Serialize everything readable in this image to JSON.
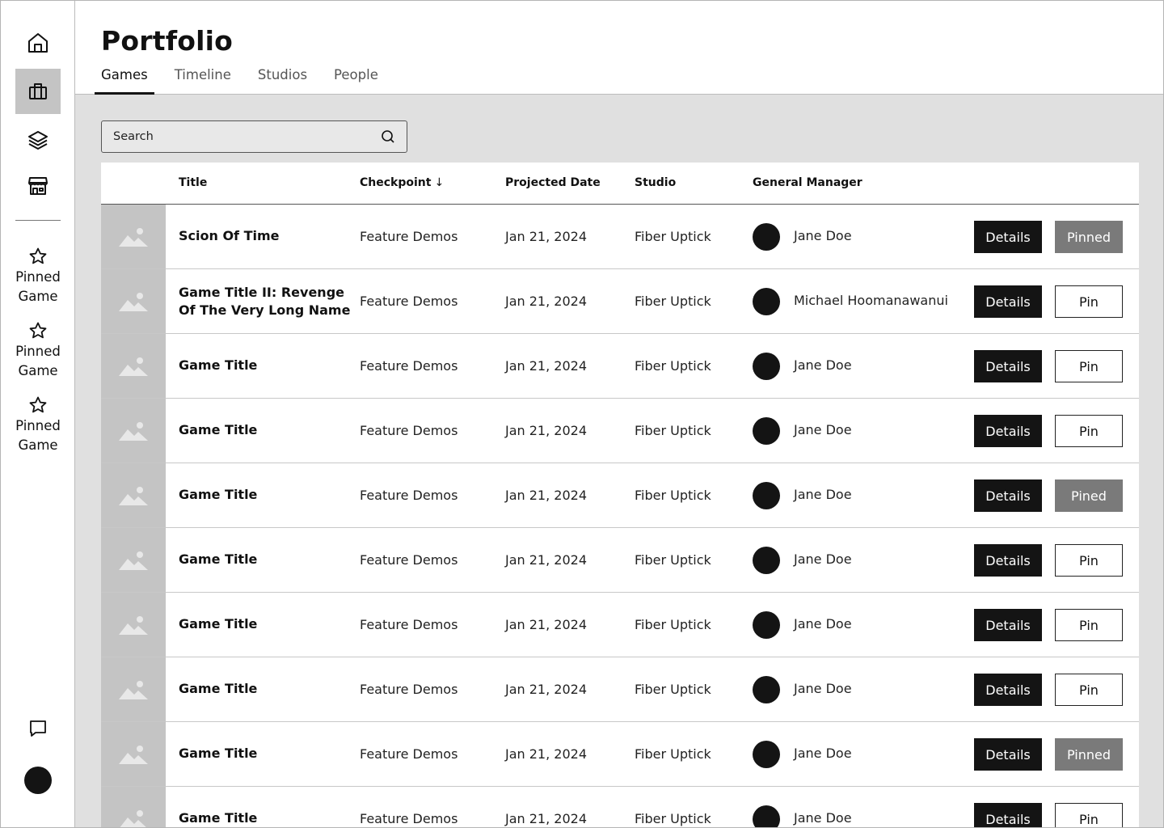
{
  "app": {
    "title": "Portfolio"
  },
  "sidebar": {
    "nav": [
      {
        "icon": "home-icon",
        "active": false
      },
      {
        "icon": "briefcase-icon",
        "active": true
      },
      {
        "icon": "layers-icon",
        "active": false
      },
      {
        "icon": "store-icon",
        "active": false
      }
    ],
    "pinned": [
      {
        "label": "Pinned Game",
        "icon": "star-icon"
      },
      {
        "label": "Pinned Game",
        "icon": "star-icon"
      },
      {
        "label": "Pinned Game",
        "icon": "star-icon"
      }
    ],
    "bottom": {
      "chat_icon": "chat-icon",
      "avatar": "user-avatar"
    }
  },
  "tabs": [
    {
      "label": "Games",
      "active": true
    },
    {
      "label": "Timeline",
      "active": false
    },
    {
      "label": "Studios",
      "active": false
    },
    {
      "label": "People",
      "active": false
    }
  ],
  "search": {
    "placeholder": "Search",
    "value": ""
  },
  "table": {
    "columns": {
      "title": "Title",
      "checkpoint": "Checkpoint",
      "checkpoint_sort": "↓",
      "projected_date": "Projected Date",
      "studio": "Studio",
      "general_manager": "General Manager"
    },
    "details_label": "Details",
    "rows": [
      {
        "title": "Scion Of Time",
        "checkpoint": "Feature Demos",
        "date": "Jan 21, 2024",
        "studio": "Fiber Uptick",
        "manager": "Jane Doe",
        "pin_label": "Pinned",
        "pinned": true
      },
      {
        "title": "Game Title II: Revenge Of The Very Long Name",
        "checkpoint": "Feature Demos",
        "date": "Jan 21, 2024",
        "studio": "Fiber Uptick",
        "manager": "Michael Hoomanawanui",
        "pin_label": "Pin",
        "pinned": false
      },
      {
        "title": "Game Title",
        "checkpoint": "Feature Demos",
        "date": "Jan 21, 2024",
        "studio": "Fiber Uptick",
        "manager": "Jane Doe",
        "pin_label": "Pin",
        "pinned": false
      },
      {
        "title": "Game Title",
        "checkpoint": "Feature Demos",
        "date": "Jan 21, 2024",
        "studio": "Fiber Uptick",
        "manager": "Jane Doe",
        "pin_label": "Pin",
        "pinned": false
      },
      {
        "title": "Game Title",
        "checkpoint": "Feature Demos",
        "date": "Jan 21, 2024",
        "studio": "Fiber Uptick",
        "manager": "Jane Doe",
        "pin_label": "Pined",
        "pinned": true
      },
      {
        "title": "Game Title",
        "checkpoint": "Feature Demos",
        "date": "Jan 21, 2024",
        "studio": "Fiber Uptick",
        "manager": "Jane Doe",
        "pin_label": "Pin",
        "pinned": false
      },
      {
        "title": "Game Title",
        "checkpoint": "Feature Demos",
        "date": "Jan 21, 2024",
        "studio": "Fiber Uptick",
        "manager": "Jane Doe",
        "pin_label": "Pin",
        "pinned": false
      },
      {
        "title": "Game Title",
        "checkpoint": "Feature Demos",
        "date": "Jan 21, 2024",
        "studio": "Fiber Uptick",
        "manager": "Jane Doe",
        "pin_label": "Pin",
        "pinned": false
      },
      {
        "title": "Game Title",
        "checkpoint": "Feature Demos",
        "date": "Jan 21, 2024",
        "studio": "Fiber Uptick",
        "manager": "Jane Doe",
        "pin_label": "Pinned",
        "pinned": true
      },
      {
        "title": "Game Title",
        "checkpoint": "Feature Demos",
        "date": "Jan 21, 2024",
        "studio": "Fiber Uptick",
        "manager": "Jane Doe",
        "pin_label": "Pin",
        "pinned": false
      }
    ]
  },
  "colors": {
    "accent": "#141414",
    "pinned_bg": "#7a7a7a",
    "main_bg": "#e0e0e0",
    "thumb_bg": "#c4c4c4"
  }
}
